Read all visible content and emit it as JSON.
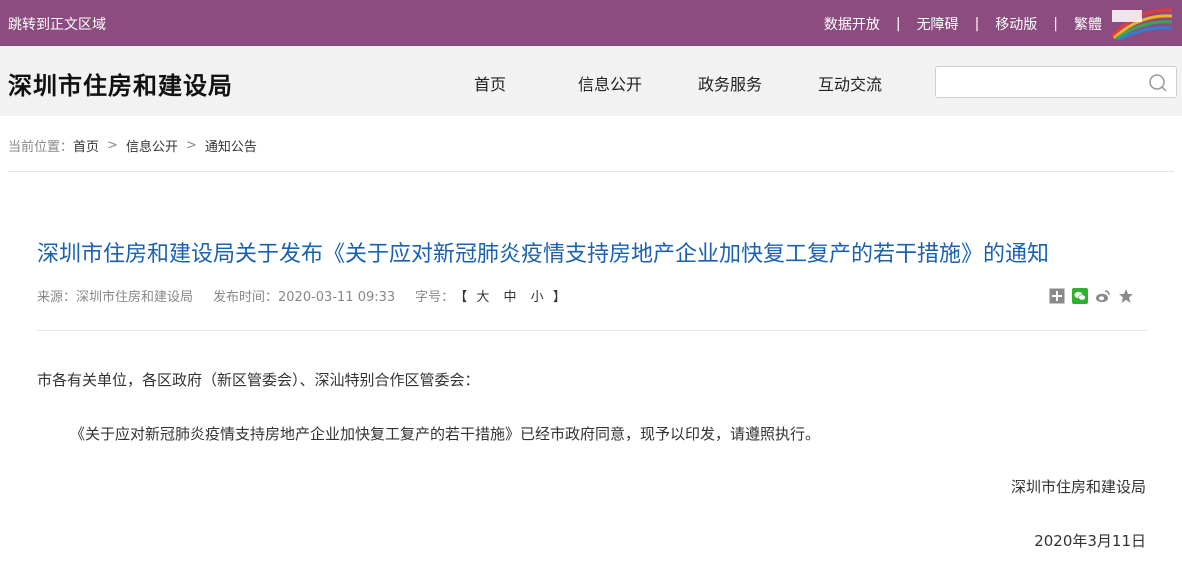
{
  "topbar": {
    "skip_link": "跳转到正文区域",
    "links": [
      "数据开放",
      "无障碍",
      "移动版",
      "繁體"
    ],
    "separator": "|"
  },
  "header": {
    "site_title": "深圳市住房和建设局",
    "nav": [
      "首页",
      "信息公开",
      "政务服务",
      "互动交流"
    ],
    "search": {
      "value": "",
      "icon": "search-icon"
    }
  },
  "breadcrumb": {
    "prefix": "当前位置：",
    "items": [
      "首页",
      "信息公开",
      "通知公告"
    ],
    "separator": ">"
  },
  "article": {
    "title": "深圳市住房和建设局关于发布《关于应对新冠肺炎疫情支持房地产企业加快复工复产的若干措施》的通知",
    "source": "来源：深圳市住房和建设局",
    "publish_time": "发布时间：2020-03-11 09:33",
    "font_size_label": "字号：",
    "font_size_open": "【",
    "font_size_options": [
      "大",
      "中",
      "小"
    ],
    "font_size_close": "】",
    "share_icons": [
      "plus-share-icon",
      "wechat-icon",
      "weibo-icon",
      "star-favorite-icon"
    ],
    "salutation": "市各有关单位，各区政府（新区管委会）、深汕特别合作区管委会：",
    "body": "《关于应对新冠肺炎疫情支持房地产企业加快复工复产的若干措施》已经市政府同意，现予以印发，请遵照执行。",
    "signature": "深圳市住房和建设局",
    "date": "2020年3月11日"
  },
  "colors": {
    "topbar_bg": "#8d4c80",
    "header_bg": "#f2f2f2",
    "title_blue": "#1a62b0"
  }
}
